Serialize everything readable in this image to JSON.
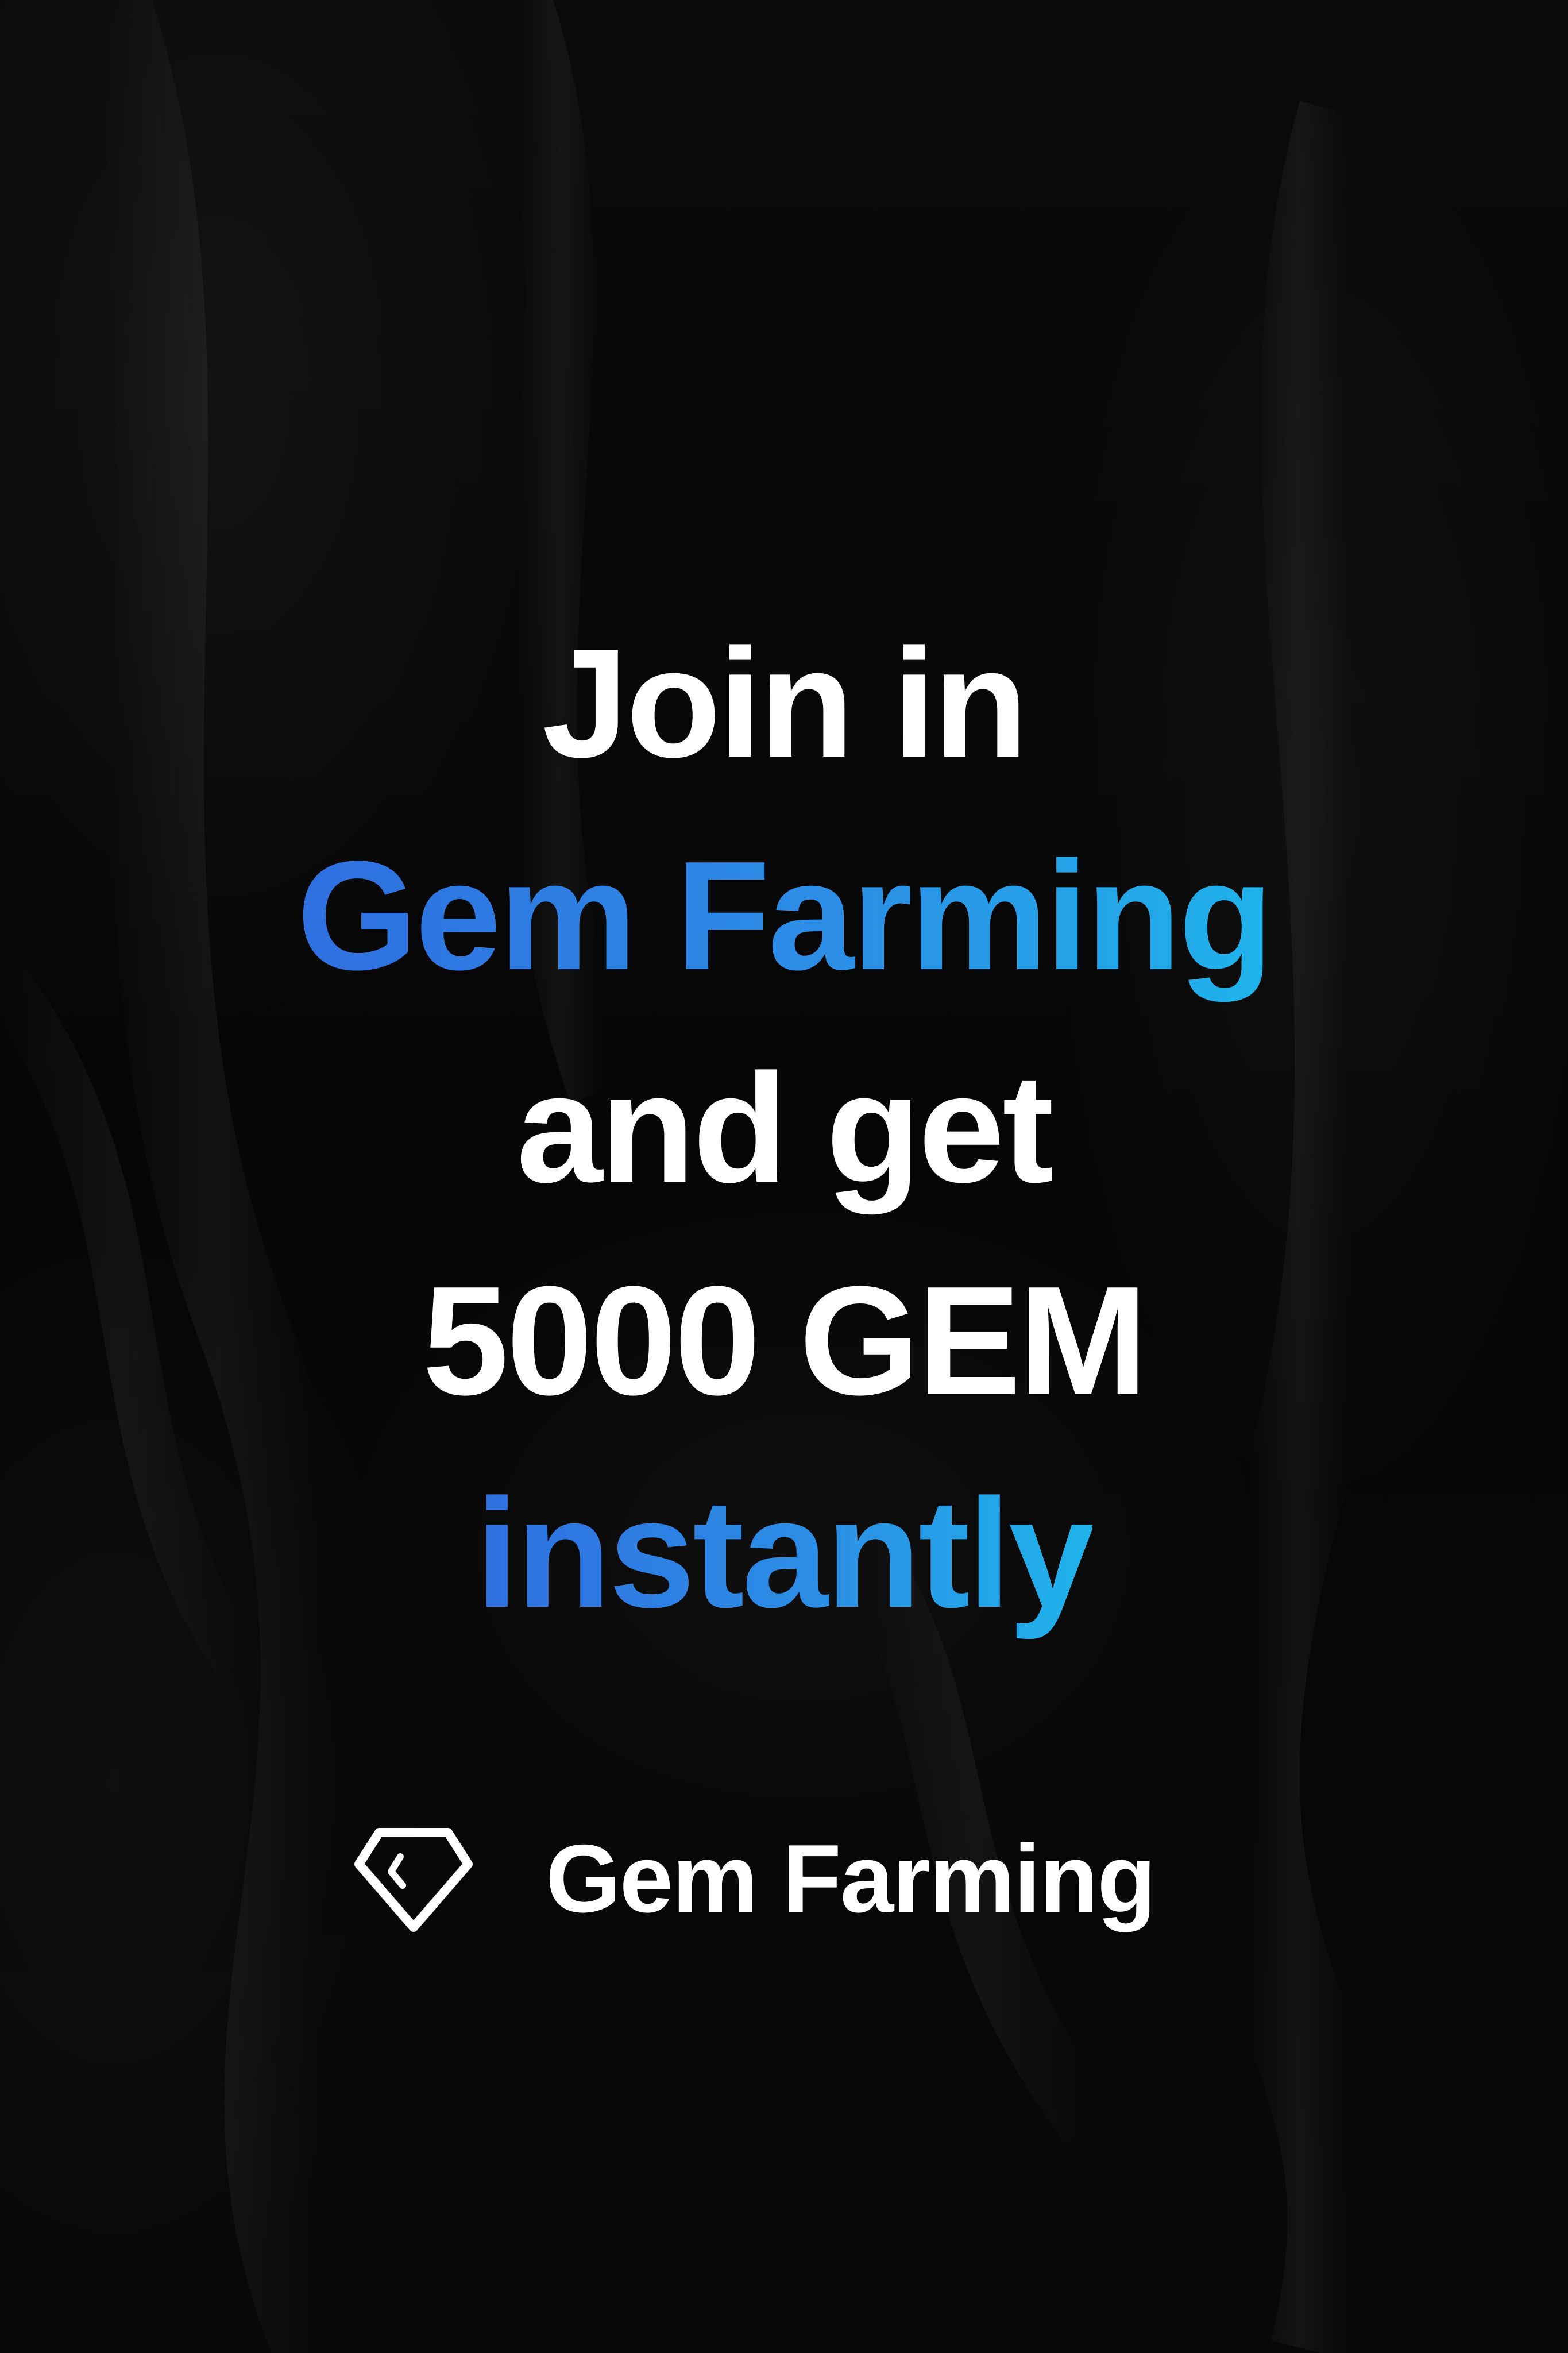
{
  "headline": {
    "line1": "Join in",
    "line2": "Gem Farming",
    "line3": "and get",
    "line4": "5000 GEM",
    "line5": "instantly"
  },
  "brand": {
    "name": "Gem Farming",
    "logo_icon": "gem-icon"
  },
  "colors": {
    "background": "#070707",
    "text": "#ffffff",
    "accent_start": "#2f6fe0",
    "accent_end": "#1fb3ea"
  }
}
